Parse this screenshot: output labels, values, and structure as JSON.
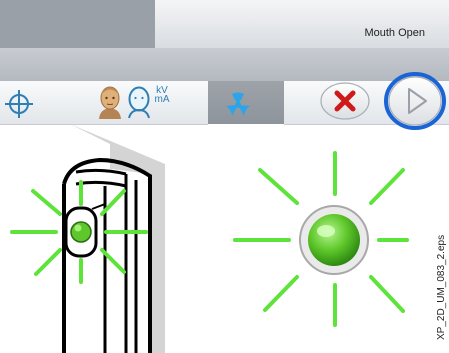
{
  "header": {
    "mode_label": "Mouth Open"
  },
  "toolbar": {
    "kv_top": "kV",
    "kv_bottom": "mA",
    "cancel_label": "Cancel",
    "start_label": "Start"
  },
  "footer": {
    "figure_code": "XP_2D_UM_083_2.eps"
  },
  "colors": {
    "accent_blue": "#1a64d6",
    "cancel_red": "#d01a1a",
    "indicator_green": "#5ec72a",
    "ray_green": "#5ee33a",
    "toolbar_gray": "#9ea3aa"
  },
  "icons": [
    "target-icon",
    "head-icon",
    "head-outline-icon",
    "radiation-icon",
    "close-icon",
    "play-icon"
  ]
}
